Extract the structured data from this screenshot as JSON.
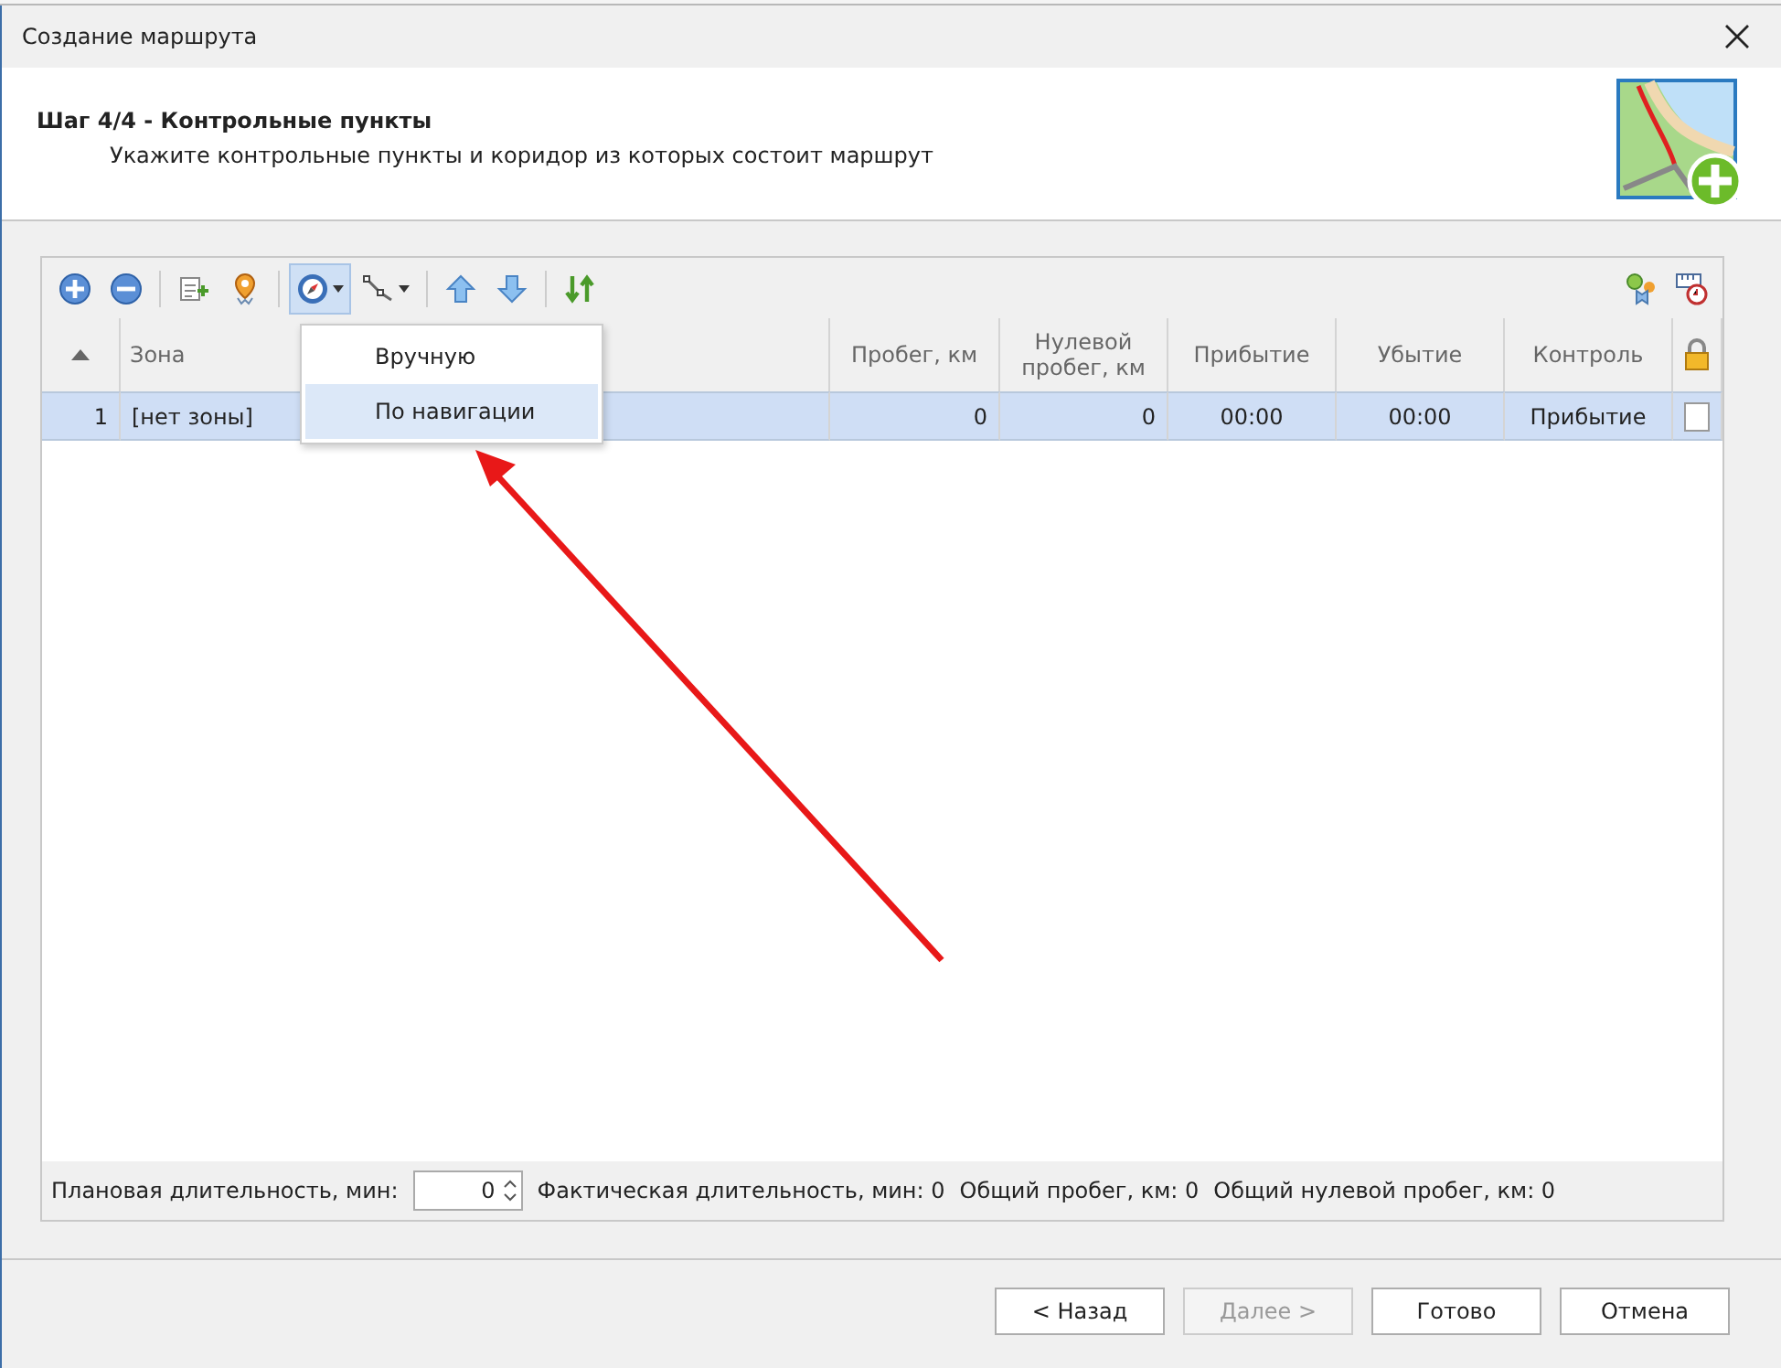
{
  "window": {
    "title": "Создание маршрута"
  },
  "header": {
    "title": "Шаг 4/4 - Контрольные пункты",
    "subtitle": "Укажите контрольные пункты и коридор из которых состоит маршрут"
  },
  "toolbar": {
    "left": [
      [
        {
          "kind": "add",
          "pressed": false
        },
        {
          "kind": "remove",
          "pressed": false
        }
      ],
      [
        {
          "kind": "add-row",
          "pressed": false
        },
        {
          "kind": "pin",
          "pressed": false
        }
      ],
      [
        {
          "kind": "compass",
          "pressed": true
        },
        {
          "kind": "polyline",
          "pressed": false
        }
      ],
      [
        {
          "kind": "up",
          "pressed": false
        },
        {
          "kind": "down",
          "pressed": false
        }
      ],
      [
        {
          "kind": "sort",
          "pressed": false
        }
      ]
    ],
    "right": [
      [
        {
          "kind": "markers",
          "pressed": false
        },
        {
          "kind": "ruler-clock",
          "pressed": false
        }
      ]
    ]
  },
  "menu": {
    "items": [
      {
        "label": "Вручную",
        "selected": false
      },
      {
        "label": "По навигации",
        "selected": true
      }
    ]
  },
  "table": {
    "columns": [
      {
        "kind": "sort"
      },
      {
        "label": "Зона",
        "kind": "text"
      },
      {
        "label": "Пробег, км",
        "kind": "text"
      },
      {
        "label": "Нулевой пробег, км",
        "kind": "text"
      },
      {
        "label": "Прибытие",
        "kind": "text"
      },
      {
        "label": "Убытие",
        "kind": "text"
      },
      {
        "label": "Контроль",
        "kind": "text"
      },
      {
        "kind": "lock"
      }
    ],
    "rows": [
      {
        "number": "1",
        "zone": "[нет зоны]",
        "mileage": "0",
        "zero_mileage": "0",
        "arrival": "00:00",
        "departure": "00:00",
        "control": "Прибытие",
        "locked": false,
        "selected": true
      }
    ]
  },
  "summary": {
    "planned_label": "Плановая длительность, мин:",
    "planned_value": "0",
    "stats": [
      "Фактическая длительность, мин: 0",
      "Общий пробег, км: 0",
      "Общий нулевой пробег, км: 0"
    ]
  },
  "buttons": [
    {
      "label": "< Назад",
      "disabled": false
    },
    {
      "label": "Далее >",
      "disabled": true
    },
    {
      "label": "Готово",
      "disabled": false
    },
    {
      "label": "Отмена",
      "disabled": false
    }
  ]
}
